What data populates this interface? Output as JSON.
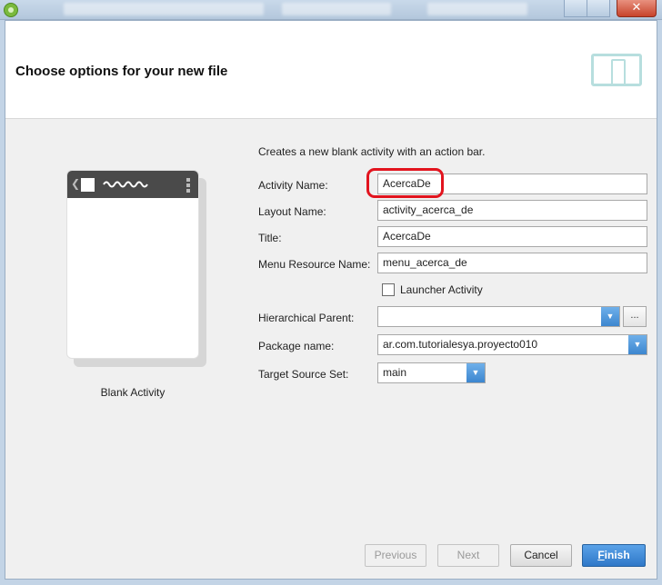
{
  "window": {
    "close_glyph": "✕"
  },
  "dialog": {
    "title": "Choose options for your new file"
  },
  "preview": {
    "label": "Blank Activity"
  },
  "form": {
    "description": "Creates a new blank activity with an action bar.",
    "activity_name": {
      "label": "Activity Name:",
      "value": "AcercaDe"
    },
    "layout_name": {
      "label": "Layout Name:",
      "value": "activity_acerca_de"
    },
    "title": {
      "label": "Title:",
      "value": "AcercaDe"
    },
    "menu_resource_name": {
      "label": "Menu Resource Name:",
      "value": "menu_acerca_de"
    },
    "launcher_activity": {
      "label": "Launcher Activity",
      "checked": false
    },
    "hierarchical_parent": {
      "label": "Hierarchical Parent:",
      "value": "",
      "browse_label": "..."
    },
    "package_name": {
      "label": "Package name:",
      "value": "ar.com.tutorialesya.proyecto010"
    },
    "target_source_set": {
      "label": "Target Source Set:",
      "value": "main"
    }
  },
  "buttons": {
    "previous": "Previous",
    "next": "Next",
    "cancel": "Cancel",
    "finish_first": "F",
    "finish_rest": "inish"
  },
  "colors": {
    "highlight": "#e2141e",
    "primary": "#2f78c8"
  }
}
